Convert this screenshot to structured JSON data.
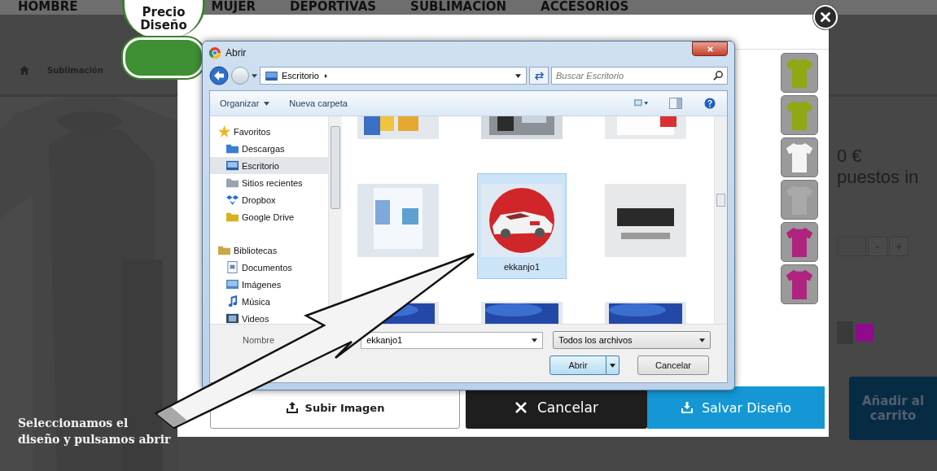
{
  "nav": [
    {
      "label": "HOMBRE"
    },
    {
      "label": "MUJER"
    },
    {
      "label": "DEPORTIVAS"
    },
    {
      "label": "SUBLIMACION"
    },
    {
      "label": "ACCESORIOS"
    }
  ],
  "breadcrumb": [
    "Sublimación"
  ],
  "price_badge": {
    "label": "Precio Diseño"
  },
  "product": {
    "price": "0 €",
    "tax_note": "puestos in",
    "quantity_buttons": [
      "-",
      "+"
    ],
    "swatches": [
      {
        "color": "#8e0b8c"
      }
    ],
    "add_to_cart": "Añadir al carrito"
  },
  "designer": {
    "shirt_colors": [
      {
        "color": "#8fa814"
      },
      {
        "color": "#8fa814"
      },
      {
        "color": "#f4f4f4"
      },
      {
        "color": "#a9a9a9"
      },
      {
        "color": "#b0237f"
      },
      {
        "color": "#b0237f"
      }
    ],
    "upload_button": "Subir Imagen",
    "cancel_button": "Cancelar",
    "save_button": "Salvar Diseño"
  },
  "file_dialog": {
    "title": "Abrir",
    "address": "Escritorio",
    "search_placeholder": "Buscar Escritorio",
    "toolbar": [
      "Organizar",
      "Nueva carpeta"
    ],
    "nav_tree": [
      {
        "label": "Favoritos",
        "kind": "star",
        "selected": false,
        "children": [
          {
            "label": "Descargas",
            "kind": "downloads",
            "selected": false
          },
          {
            "label": "Escritorio",
            "kind": "desktop",
            "selected": true
          },
          {
            "label": "Sitios recientes",
            "kind": "recent",
            "selected": false
          },
          {
            "label": "Dropbox",
            "kind": "dropbox",
            "selected": false
          },
          {
            "label": "Google Drive",
            "kind": "drive",
            "selected": false
          }
        ]
      },
      {
        "label": "Bibliotecas",
        "kind": "library",
        "selected": false,
        "children": [
          {
            "label": "Documentos",
            "kind": "documents",
            "selected": false
          },
          {
            "label": "Imágenes",
            "kind": "images",
            "selected": false
          },
          {
            "label": "Música",
            "kind": "music",
            "selected": false
          },
          {
            "label": "Videos",
            "kind": "videos",
            "selected": false
          }
        ]
      }
    ],
    "files": [
      {
        "kind": "picture",
        "selected": false
      },
      {
        "kind": "picture",
        "selected": false
      },
      {
        "kind": "picture",
        "selected": false
      },
      {
        "kind": "picture",
        "selected": false
      },
      {
        "kind": "picture",
        "name": "ekkanjo1",
        "selected": true
      },
      {
        "kind": "picture",
        "selected": false
      },
      {
        "kind": "picture",
        "selected": false
      },
      {
        "kind": "picture",
        "selected": false
      },
      {
        "kind": "picture",
        "selected": false
      }
    ],
    "filename_label": "Nombre",
    "filename": "ekkanjo1",
    "filter": "Todos los archivos",
    "buttons": [
      "Abrir",
      "Cancelar"
    ]
  },
  "annotation": {
    "lines": [
      "Seleccionamos el",
      "diseño y pulsamos abrir"
    ]
  }
}
